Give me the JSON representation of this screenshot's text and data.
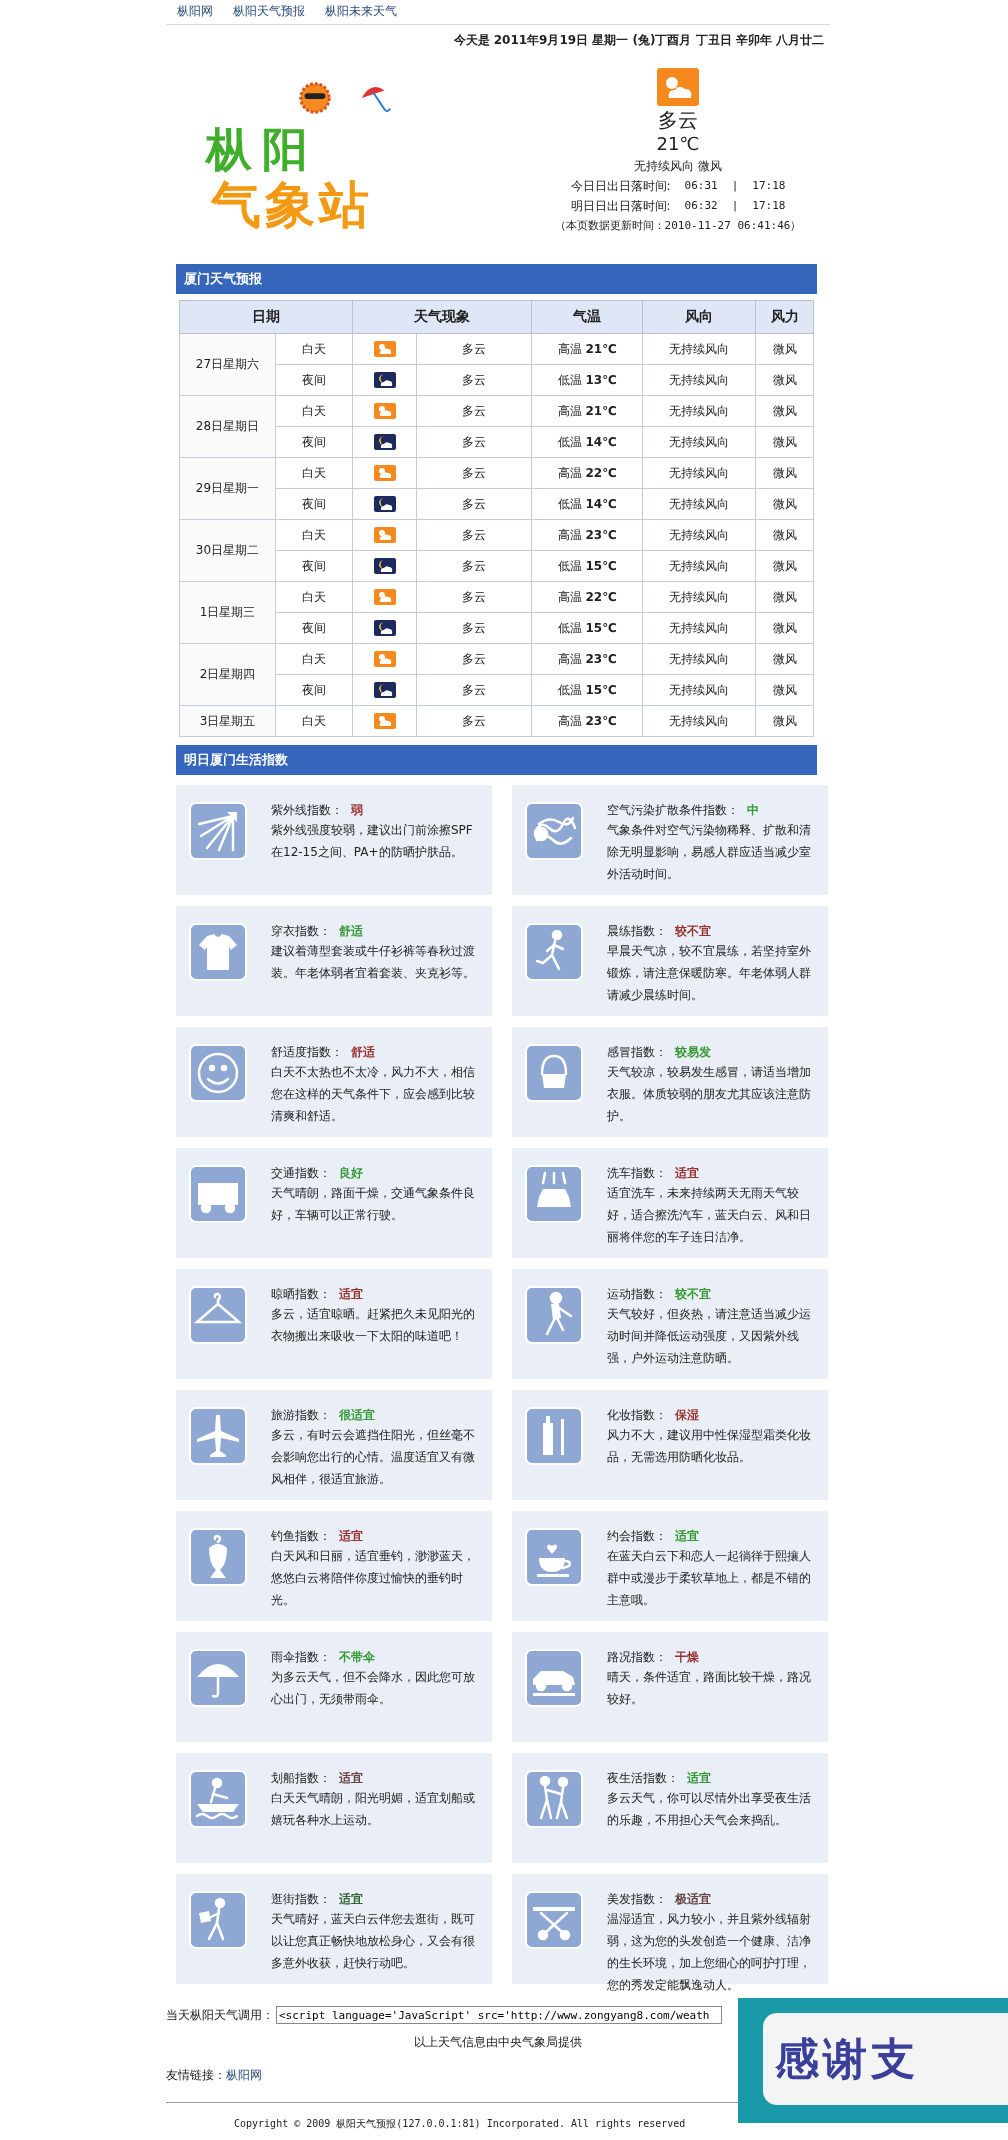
{
  "nav": [
    {
      "label": "枞阳网"
    },
    {
      "label": "枞阳天气预报"
    },
    {
      "label": "枞阳未来天气"
    }
  ],
  "today_line": "今天是 2011年9月19日 星期一 (兔)丁酉月 丁丑日 辛卯年 八月廿二",
  "logo": {
    "line1": "枞阳",
    "line2": "气象站"
  },
  "current": {
    "weather": "多云",
    "temp": "21℃",
    "wind": "无持续风向 微风",
    "sun_rows": [
      {
        "label": "今日日出日落时间:",
        "rise": "06:31",
        "sep": "|",
        "set": "17:18"
      },
      {
        "label": "明日日出日落时间:",
        "rise": "06:32",
        "sep": "|",
        "set": "17:18"
      }
    ],
    "updated": "（本页数据更新时间：2010-11-27 06:41:46）"
  },
  "forecast": {
    "title": "厦门天气预报",
    "columns": [
      "日期",
      "天气现象",
      "气温",
      "风向",
      "风力"
    ],
    "days": [
      {
        "date": "27日星期六",
        "periods": [
          {
            "time": "白天",
            "kind": "day",
            "weather": "多云",
            "temp": "高温 **21℃**",
            "wind_dir": "无持续风向",
            "wind_force": "微风"
          },
          {
            "time": "夜间",
            "kind": "night",
            "weather": "多云",
            "temp": "低温 **13℃**",
            "wind_dir": "无持续风向",
            "wind_force": "微风"
          }
        ]
      },
      {
        "date": "28日星期日",
        "periods": [
          {
            "time": "白天",
            "kind": "day",
            "weather": "多云",
            "temp": "高温 **21℃**",
            "wind_dir": "无持续风向",
            "wind_force": "微风"
          },
          {
            "time": "夜间",
            "kind": "night",
            "weather": "多云",
            "temp": "低温 **14℃**",
            "wind_dir": "无持续风向",
            "wind_force": "微风"
          }
        ]
      },
      {
        "date": "29日星期一",
        "periods": [
          {
            "time": "白天",
            "kind": "day",
            "weather": "多云",
            "temp": "高温 **22℃**",
            "wind_dir": "无持续风向",
            "wind_force": "微风"
          },
          {
            "time": "夜间",
            "kind": "night",
            "weather": "多云",
            "temp": "低温 **14℃**",
            "wind_dir": "无持续风向",
            "wind_force": "微风"
          }
        ]
      },
      {
        "date": "30日星期二",
        "periods": [
          {
            "time": "白天",
            "kind": "day",
            "weather": "多云",
            "temp": "高温 **23℃**",
            "wind_dir": "无持续风向",
            "wind_force": "微风"
          },
          {
            "time": "夜间",
            "kind": "night",
            "weather": "多云",
            "temp": "低温 **15℃**",
            "wind_dir": "无持续风向",
            "wind_force": "微风"
          }
        ]
      },
      {
        "date": "1日星期三",
        "periods": [
          {
            "time": "白天",
            "kind": "day",
            "weather": "多云",
            "temp": "高温 **22℃**",
            "wind_dir": "无持续风向",
            "wind_force": "微风"
          },
          {
            "time": "夜间",
            "kind": "night",
            "weather": "多云",
            "temp": "低温 **15℃**",
            "wind_dir": "无持续风向",
            "wind_force": "微风"
          }
        ]
      },
      {
        "date": "2日星期四",
        "periods": [
          {
            "time": "白天",
            "kind": "day",
            "weather": "多云",
            "temp": "高温 **23℃**",
            "wind_dir": "无持续风向",
            "wind_force": "微风"
          },
          {
            "time": "夜间",
            "kind": "night",
            "weather": "多云",
            "temp": "低温 **15℃**",
            "wind_dir": "无持续风向",
            "wind_force": "微风"
          }
        ]
      },
      {
        "date": "3日星期五",
        "periods": [
          {
            "time": "白天",
            "kind": "day",
            "weather": "多云",
            "temp": "高温 **23℃**",
            "wind_dir": "无持续风向",
            "wind_force": "微风"
          }
        ]
      }
    ]
  },
  "life": {
    "title": "明日厦门生活指数",
    "items": [
      {
        "kind": "uv",
        "label": "紫外线指数：",
        "value": "弱",
        "color": "#993333",
        "text": "紫外线强度较弱，建议出门前涂擦SPF在12-15之间、PA+的防晒护肤品。"
      },
      {
        "kind": "air",
        "label": "空气污染扩散条件指数：",
        "value": "中",
        "color": "#339933",
        "text": "气象条件对空气污染物稀释、扩散和清除无明显影响，易感人群应适当减少室外活动时间。"
      },
      {
        "kind": "dress",
        "label": "穿衣指数：",
        "value": "舒适",
        "color": "#339933",
        "text": "建议着薄型套装或牛仔衫裤等春秋过渡装。年老体弱者宜着套装、夹克衫等。"
      },
      {
        "kind": "run",
        "label": "晨练指数：",
        "value": "较不宜",
        "color": "#993333",
        "text": "早晨天气凉，较不宜晨练，若坚持室外锻炼，请注意保暖防寒。年老体弱人群请减少晨练时间。"
      },
      {
        "kind": "comfort",
        "label": "舒适度指数：",
        "value": "舒适",
        "color": "#993333",
        "text": "白天不太热也不太冷，风力不大，相信您在这样的天气条件下，应会感到比较清爽和舒适。"
      },
      {
        "kind": "cold",
        "label": "感冒指数：",
        "value": "较易发",
        "color": "#339933",
        "text": "天气较凉，较易发生感冒，请适当增加衣服。体质较弱的朋友尤其应该注意防护。"
      },
      {
        "kind": "traffic",
        "label": "交通指数：",
        "value": "良好",
        "color": "#339933",
        "text": "天气晴朗，路面干燥，交通气象条件良好，车辆可以正常行驶。"
      },
      {
        "kind": "carwash",
        "label": "洗车指数：",
        "value": "适宜",
        "color": "#993333",
        "text": "适宜洗车，未来持续两天无雨天气较好，适合擦洗汽车，蓝天白云、风和日丽将伴您的车子连日洁净。"
      },
      {
        "kind": "dry",
        "label": "晾晒指数：",
        "value": "适宜",
        "color": "#993333",
        "text": "多云，适宜晾晒。赶紧把久未见阳光的衣物搬出来吸收一下太阳的味道吧！"
      },
      {
        "kind": "sport",
        "label": "运动指数：",
        "value": "较不宜",
        "color": "#339933",
        "text": "天气较好，但炎热，请注意适当减少运动时间并降低运动强度，又因紫外线强，户外运动注意防晒。"
      },
      {
        "kind": "travel",
        "label": "旅游指数：",
        "value": "很适宜",
        "color": "#339933",
        "text": "多云，有时云会遮挡住阳光，但丝毫不会影响您出行的心情。温度适宜又有微风相伴，很适宜旅游。"
      },
      {
        "kind": "makeup",
        "label": "化妆指数：",
        "value": "保湿",
        "color": "#993333",
        "text": "风力不大，建议用中性保湿型霜类化妆品，无需选用防晒化妆品。"
      },
      {
        "kind": "fish",
        "label": "钓鱼指数：",
        "value": "适宜",
        "color": "#993333",
        "text": "白天风和日丽，适宜垂钓，渺渺蓝天，悠悠白云将陪伴你度过愉快的垂钓时光。"
      },
      {
        "kind": "date",
        "label": "约会指数：",
        "value": "适宜",
        "color": "#339933",
        "text": "在蓝天白云下和恋人一起徜徉于熙攘人群中或漫步于柔软草地上，都是不错的主意哦。"
      },
      {
        "kind": "umbrella",
        "label": "雨伞指数：",
        "value": "不带伞",
        "color": "#339933",
        "text": "为多云天气，但不会降水，因此您可放心出门，无须带雨伞。"
      },
      {
        "kind": "road",
        "label": "路况指数：",
        "value": "干燥",
        "color": "#993333",
        "text": "晴天，条件适宜，路面比较干燥，路况较好。"
      },
      {
        "kind": "boat",
        "label": "划船指数：",
        "value": "适宜",
        "color": "#664444",
        "text": "白天天气晴朗，阳光明媚，适宜划船或嬉玩各种水上运动。"
      },
      {
        "kind": "night",
        "label": "夜生活指数：",
        "value": "适宜",
        "color": "#339933",
        "text": "多云天气，你可以尽情外出享受夜生活的乐趣，不用担心天气会来捣乱。"
      },
      {
        "kind": "shop",
        "label": "逛街指数：",
        "value": "适宜",
        "color": "#336633",
        "text": "天气晴好，蓝天白云伴您去逛街，既可以让您真正畅快地放松身心，又会有很多意外收获，赶快行动吧。"
      },
      {
        "kind": "hair",
        "label": "美发指数：",
        "value": "极适宜",
        "color": "#664444",
        "text": "温湿适宜，风力较小，并且紫外线辐射弱，这为您的头发创造一个健康、洁净的生长环境，加上您细心的呵护打理，您的秀发定能飘逸动人。"
      }
    ]
  },
  "embed": {
    "label": "当天枞阳天气调用：",
    "value": "<script language='JavaScript' src='http://www.zongyang8.com/weath"
  },
  "source_note": "以上天气信息由中央气象局提供",
  "links": {
    "label": "友情链接：",
    "items": [
      {
        "label": "枞阳网"
      }
    ]
  },
  "copyright": "Copyright © 2009 枞阳天气预报(127.0.0.1:81) Incorporated. All rights reserved",
  "floating_banner": {
    "text": "感谢支"
  }
}
